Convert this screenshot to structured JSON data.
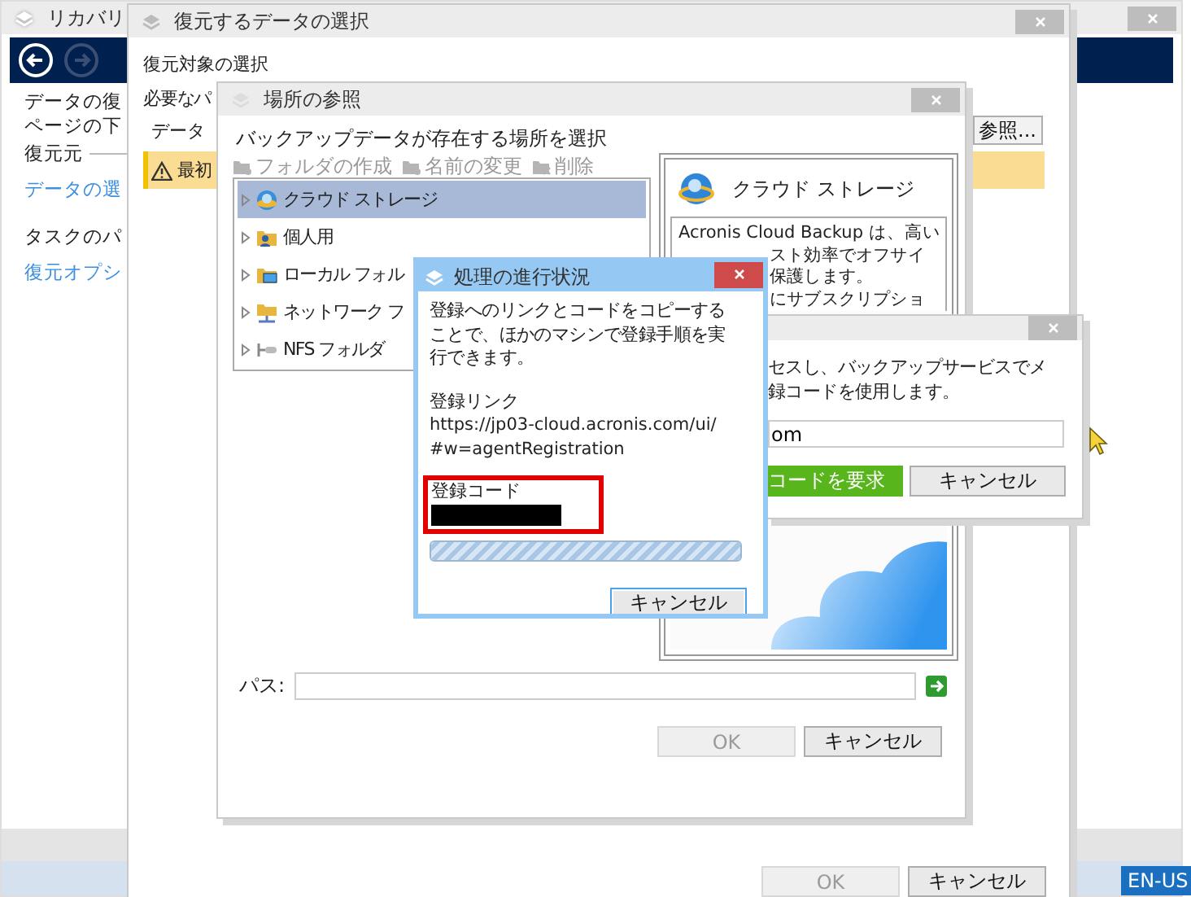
{
  "main_window": {
    "title": "リカバリ",
    "lines": [
      "データの復",
      "ページの下"
    ],
    "section_1": "復元元",
    "link_1": "データの選",
    "section_2": "タスクのパ",
    "link_2": "復元オプシ"
  },
  "restore_dialog": {
    "title": "復元するデータの選択",
    "heading": "復元対象の選択",
    "label_1": "必要なパ",
    "label_2": "データ",
    "browse_button": "参照...",
    "warning": "最初",
    "ok_button": {
      "label": "OK",
      "disabled": true
    },
    "cancel_button": "キャンセル"
  },
  "browse_dialog": {
    "title": "場所の参照",
    "instruction": "バックアップデータが存在する場所を選択",
    "toolbar": [
      {
        "label": "フォルダの作成",
        "disabled": true
      },
      {
        "label": "名前の変更",
        "disabled": true
      },
      {
        "label": "削除",
        "disabled": true
      }
    ],
    "tree": [
      {
        "label": "クラウド ストレージ",
        "kind": "cloud",
        "selected": true,
        "expanded": false
      },
      {
        "label": "個人用",
        "kind": "personal",
        "selected": false,
        "expanded": false
      },
      {
        "label": "ローカル フォル",
        "kind": "local",
        "selected": false,
        "expanded": false
      },
      {
        "label": "ネットワーク フ",
        "kind": "network",
        "selected": false,
        "expanded": false
      },
      {
        "label": "NFS フォルダ",
        "kind": "nfs",
        "selected": false,
        "expanded": false
      }
    ],
    "details": {
      "title": "クラウド ストレージ",
      "first_line": "Acronis Cloud Backup は、高い",
      "covered_lines": [
        "スト効率でオフサイ",
        "保護します。",
        "にサブスクリプショ"
      ]
    },
    "path_label": "パス:",
    "ok_button": {
      "label": "OK",
      "disabled": true
    },
    "cancel_button": "キャンセル"
  },
  "login_dialog": {
    "lines": [
      "セスし、バックアップサービスでメ",
      "録コードを使用します。"
    ],
    "field_value": "om",
    "request_button": "コードを要求",
    "cancel_button": "キャンセル"
  },
  "progress_dialog": {
    "title": "処理の進行状況",
    "message": "登録へのリンクとコードをコピーすることで、ほかのマシンで登録手順を実行できます。",
    "link_label": "登録リンク",
    "link_lines": [
      "https://jp03-cloud.acronis.com/ui/",
      "#w=agentRegistration"
    ],
    "code_label": "登録コード",
    "progress": {
      "level": 1
    },
    "cancel_button": "キャンセル"
  },
  "language_badge": "EN-US"
}
